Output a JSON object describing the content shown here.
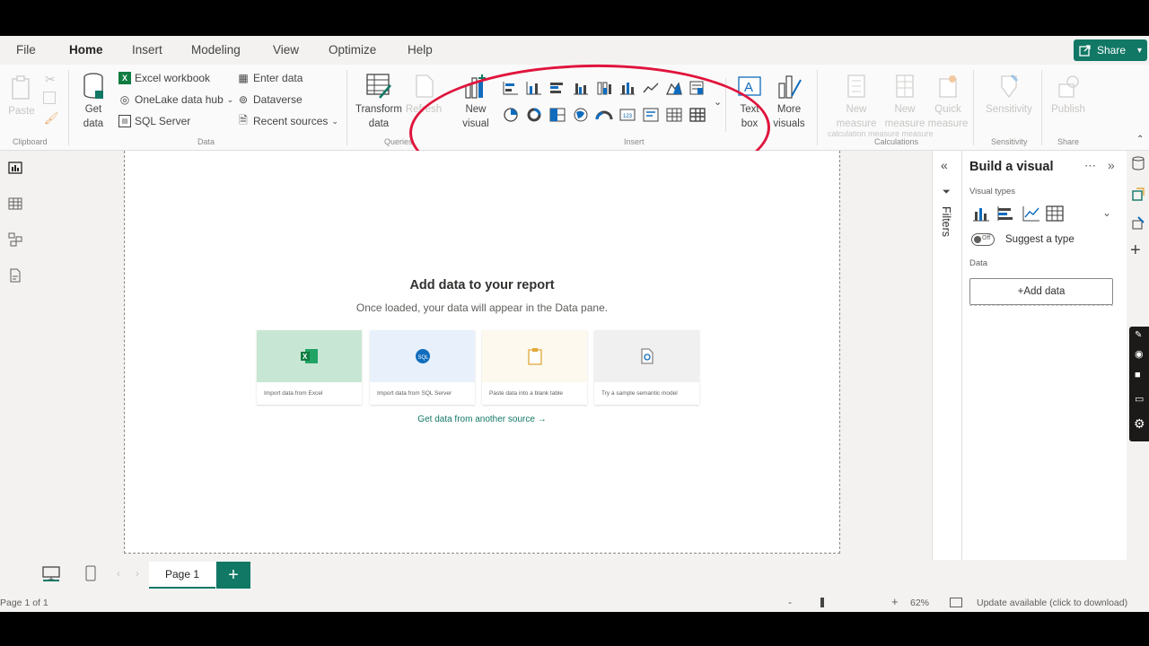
{
  "menu": {
    "tabs": [
      "File",
      "Home",
      "Insert",
      "Modeling",
      "View",
      "Optimize",
      "Help"
    ],
    "active": "Home",
    "share_label": "Share"
  },
  "ribbon": {
    "clipboard": {
      "paste": "Paste",
      "group": "Clipboard"
    },
    "data": {
      "get_data": "Get data",
      "excel": "Excel workbook",
      "onelake": "OneLake data hub",
      "sql": "SQL Server",
      "enter_data": "Enter data",
      "dataverse": "Dataverse",
      "recent": "Recent sources",
      "group": "Data"
    },
    "queries": {
      "transform": "Transform data",
      "refresh": "Refresh",
      "group": "Queries"
    },
    "insert": {
      "new_visual": "New visual",
      "text_box": "Text box",
      "more_visuals": "More visuals",
      "group": "Insert"
    },
    "calculations": {
      "new_measure": "New measure",
      "quick_measure": "Quick measure",
      "group": "Calculations",
      "calc_sub": "calculation measure measure"
    },
    "sensitivity": {
      "label": "Sensitivity",
      "group": "Sensitivity"
    },
    "share": {
      "publish": "Publish",
      "group": "Share"
    }
  },
  "canvas": {
    "title": "Add data to your report",
    "subtitle": "Once loaded, your data will appear in the Data pane.",
    "cards": [
      {
        "label": "Import data from Excel",
        "color": "#c8e6d4",
        "icon_color": "#107c41"
      },
      {
        "label": "Import data from SQL Server",
        "color": "#e8f1fb",
        "icon_color": "#0f6cbd"
      },
      {
        "label": "Paste data into a blank table",
        "color": "#fdf9ee",
        "icon_color": "#e0a93a"
      },
      {
        "label": "Try a sample semantic model",
        "color": "#f0f0f0",
        "icon_color": "#8a8886"
      }
    ],
    "another_source": "Get data from another source →"
  },
  "filters": {
    "label": "Filters"
  },
  "build": {
    "title": "Build a visual",
    "visual_types_label": "Visual types",
    "suggest_toggle": "Off",
    "suggest": "Suggest a type",
    "data_label": "Data",
    "add_data": "+Add data"
  },
  "pages": {
    "tab": "Page 1",
    "add": "+"
  },
  "status": {
    "page_count": "Page 1 of 1",
    "zoom": "62%",
    "update": "Update available (click to download)"
  },
  "colors": {
    "accent": "#117865",
    "annotation": "#e0143c"
  }
}
